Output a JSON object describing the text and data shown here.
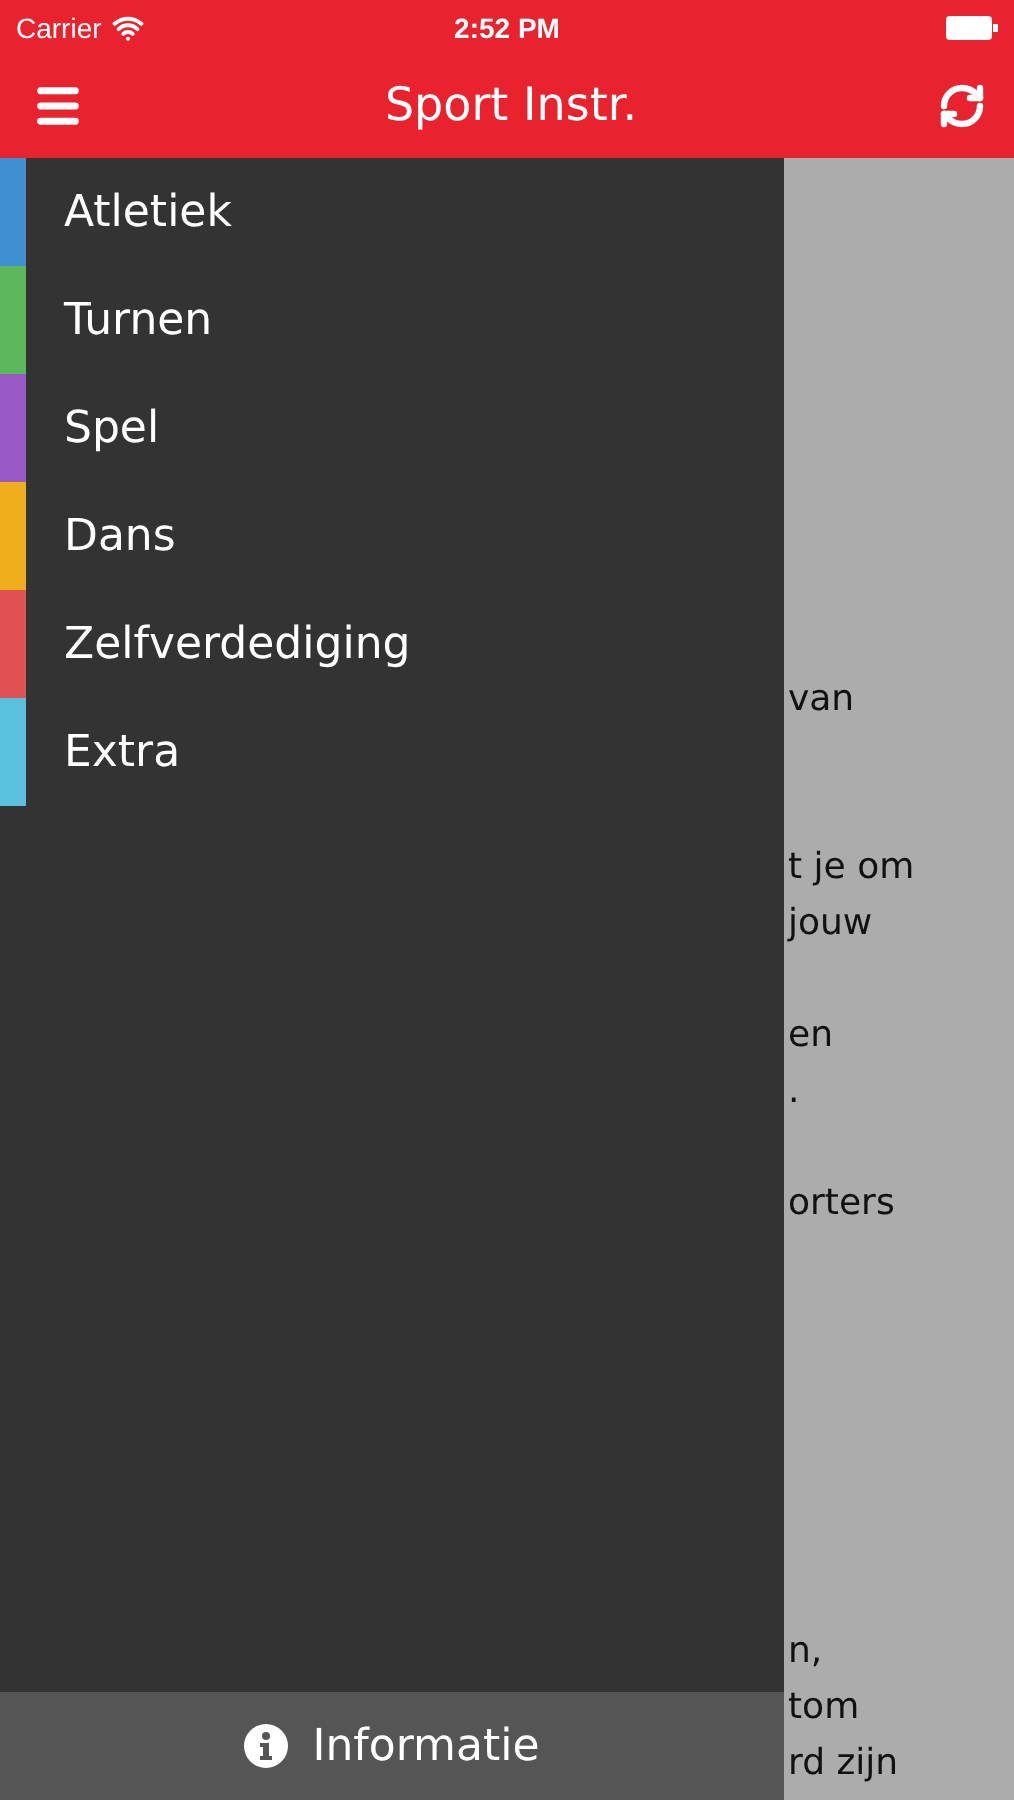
{
  "status_bar": {
    "carrier": "Carrier",
    "time": "2:52 PM"
  },
  "nav_bar": {
    "title": "Sport Instr."
  },
  "drawer": {
    "items": [
      {
        "label": "Atletiek",
        "color": "#3f8fd2"
      },
      {
        "label": "Turnen",
        "color": "#5cb85c"
      },
      {
        "label": "Spel",
        "color": "#9b59c6"
      },
      {
        "label": "Dans",
        "color": "#f0ad1c"
      },
      {
        "label": "Zelfverdediging",
        "color": "#e05252"
      },
      {
        "label": "Extra",
        "color": "#5bc0de"
      }
    ],
    "footer": {
      "label": "Informatie"
    }
  },
  "content": {
    "paragraphs": [
      {
        "lines": [
          "van"
        ]
      },
      {
        "lines": [
          "t je om",
          "jouw"
        ]
      },
      {
        "lines": [
          "en",
          "."
        ]
      },
      {
        "lines": [
          "orters"
        ]
      },
      {
        "lines": [
          "n,",
          "tom",
          "rd zijn"
        ]
      }
    ]
  }
}
